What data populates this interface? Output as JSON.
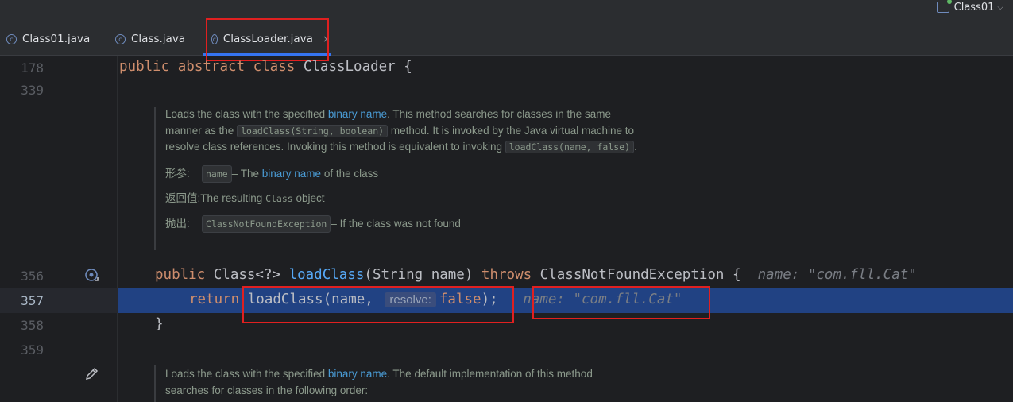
{
  "run_config": {
    "name": "Class01",
    "chevron": "⌵"
  },
  "tabs": [
    {
      "label": "Class01.java"
    },
    {
      "label": "Class.java"
    },
    {
      "label": "ClassLoader.java",
      "close": "×"
    }
  ],
  "line_numbers": {
    "l178": "178",
    "l339": "339",
    "l356": "356",
    "l357": "357",
    "l358": "358",
    "l359": "359"
  },
  "code": {
    "l178_public": "public",
    "l178_abstract": "abstract",
    "l178_class": "class",
    "l178_rest": " ClassLoader {",
    "l356_public": "public",
    "l356_type": " Class<?> ",
    "l356_fn": "loadClass",
    "l356_params": "(String name) ",
    "l356_throws": "throws",
    "l356_rest": " ClassNotFoundException {",
    "l356_hint": "name: \"com.fll.Cat\"",
    "l357_return": "return",
    "l357_fn": "loadClass",
    "l357_args": "(name, ",
    "l357_param_hint": "resolve:",
    "l357_false": "false",
    "l357_end": ");",
    "l357_hint": "name: \"com.fll.Cat\"",
    "l358": "}"
  },
  "doc1": {
    "p1": "Loads the class with the specified ",
    "p1_link": "binary name",
    "p2": ". This method searches for classes in the same manner as the ",
    "p2_code": "loadClass(String, boolean)",
    "p3": " method. It is invoked by the Java virtual machine to resolve class references. Invoking this method is equivalent to invoking ",
    "p3_code": "loadClass(name, false)",
    "p4": ".",
    "param_label": "形参:",
    "param_code": "name",
    "param_text1": " – The ",
    "param_link": "binary name",
    "param_text2": " of the class",
    "return_label": "返回值:",
    "return_text1": " The resulting ",
    "return_code": "Class",
    "return_text2": " object",
    "throws_label": "抛出:",
    "throws_code": "ClassNotFoundException",
    "throws_text": " – If the class was not found"
  },
  "doc2": {
    "p1": "Loads the class with the specified ",
    "p1_link": "binary name",
    "p2": ". The default implementation of this method searches for classes in the following order:"
  },
  "icons": {
    "override": "override-icon",
    "edit": "pencil-icon",
    "class": "class-icon"
  }
}
